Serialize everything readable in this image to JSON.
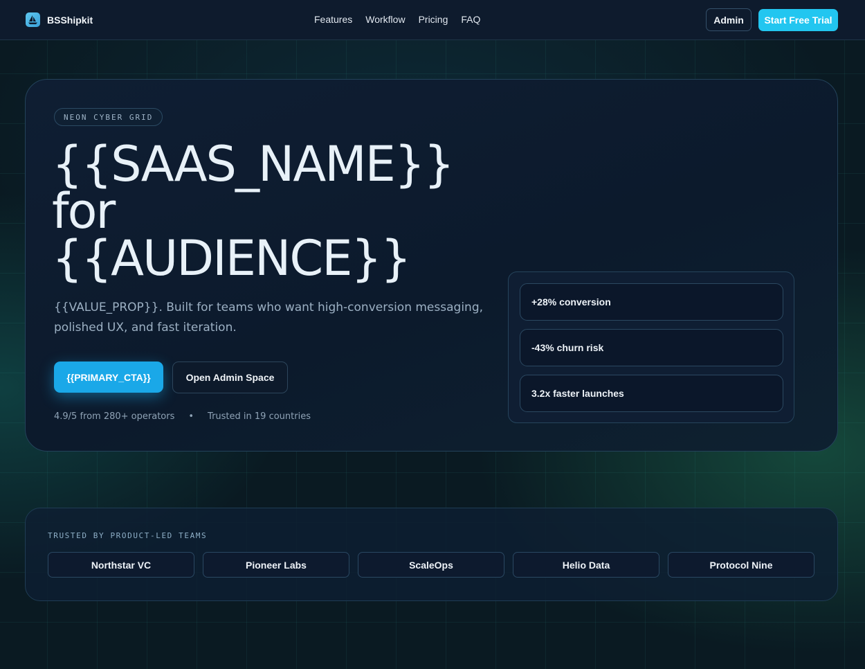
{
  "brand": {
    "name": "BSShipkit"
  },
  "nav": {
    "links": [
      "Features",
      "Workflow",
      "Pricing",
      "FAQ"
    ],
    "admin_label": "Admin",
    "trial_label": "Start Free Trial"
  },
  "hero": {
    "badge": "NEON CYBER GRID",
    "headline": [
      "{{SAAS_NAME}}",
      "for",
      "{{AUDIENCE}}"
    ],
    "subtext": "{{VALUE_PROP}}. Built for teams who want high-conversion messaging, polished UX, and fast iteration.",
    "primary_cta": "{{PRIMARY_CTA}}",
    "secondary_cta": "Open Admin Space",
    "rating": "4.9/5 from 280+ operators",
    "separator": "•",
    "trust": "Trusted in 19 countries"
  },
  "stats": [
    "+28% conversion",
    "-43% churn risk",
    "3.2x faster launches"
  ],
  "trusted": {
    "title": "TRUSTED BY PRODUCT-LED TEAMS",
    "logos": [
      "Northstar VC",
      "Pioneer Labs",
      "ScaleOps",
      "Helio Data",
      "Protocol Nine"
    ]
  },
  "colors": {
    "accent": "#22c6f0",
    "primary_button": "#1aa8e8",
    "background": "#0a1a22",
    "panel": "#0f1e33"
  }
}
